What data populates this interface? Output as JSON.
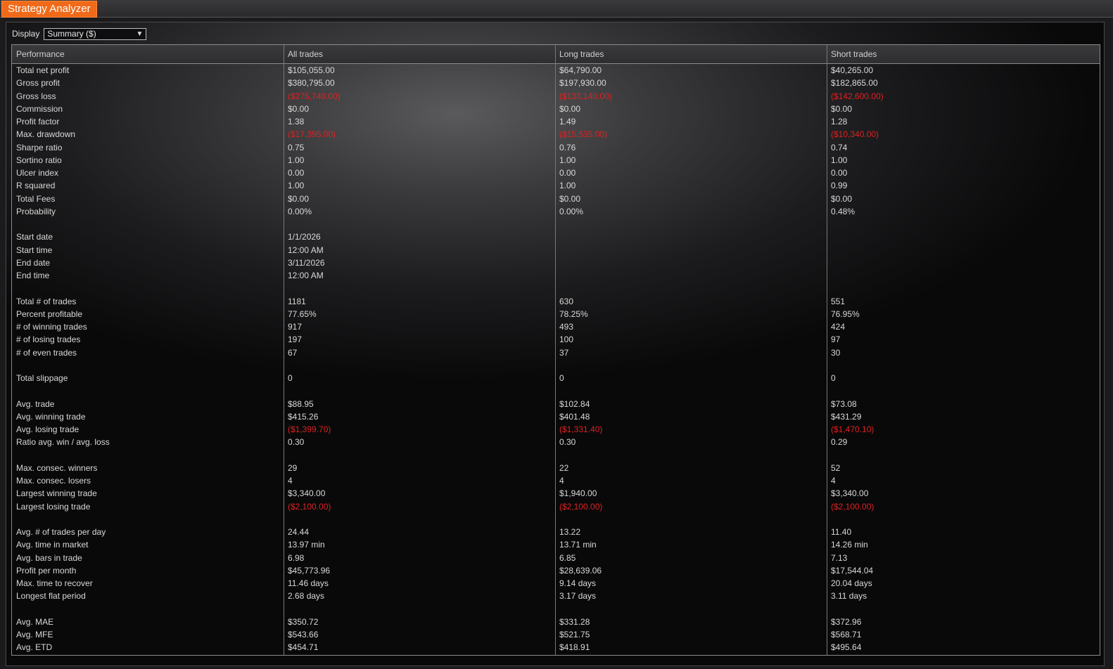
{
  "window": {
    "title": "Strategy Analyzer"
  },
  "display": {
    "label": "Display",
    "selected": "Summary ($)"
  },
  "columns": [
    "Performance",
    "All trades",
    "Long trades",
    "Short trades"
  ],
  "rows": [
    {
      "label": "Total net profit",
      "vals": [
        "$105,055.00",
        "$64,790.00",
        "$40,265.00"
      ]
    },
    {
      "label": "Gross profit",
      "vals": [
        "$380,795.00",
        "$197,930.00",
        "$182,865.00"
      ]
    },
    {
      "label": "Gross loss",
      "vals": [
        "($275,740.00)",
        "($133,140.00)",
        "($142,600.00)"
      ]
    },
    {
      "label": "Commission",
      "vals": [
        "$0.00",
        "$0.00",
        "$0.00"
      ]
    },
    {
      "label": "Profit factor",
      "vals": [
        "1.38",
        "1.49",
        "1.28"
      ]
    },
    {
      "label": "Max. drawdown",
      "vals": [
        "($17,395.00)",
        "($15,535.00)",
        "($10,340.00)"
      ]
    },
    {
      "label": "Sharpe ratio",
      "vals": [
        "0.75",
        "0.76",
        "0.74"
      ]
    },
    {
      "label": "Sortino ratio",
      "vals": [
        "1.00",
        "1.00",
        "1.00"
      ]
    },
    {
      "label": "Ulcer index",
      "vals": [
        "0.00",
        "0.00",
        "0.00"
      ]
    },
    {
      "label": "R squared",
      "vals": [
        "1.00",
        "1.00",
        "0.99"
      ]
    },
    {
      "label": "Total Fees",
      "vals": [
        "$0.00",
        "$0.00",
        "$0.00"
      ]
    },
    {
      "label": "Probability",
      "vals": [
        "0.00%",
        "0.00%",
        "0.48%"
      ]
    },
    {
      "label": "",
      "vals": [
        "",
        "",
        ""
      ]
    },
    {
      "label": "Start date",
      "vals": [
        "1/1/2026",
        "",
        ""
      ]
    },
    {
      "label": "Start time",
      "vals": [
        "12:00 AM",
        "",
        ""
      ]
    },
    {
      "label": "End date",
      "vals": [
        "3/11/2026",
        "",
        ""
      ]
    },
    {
      "label": "End time",
      "vals": [
        "12:00 AM",
        "",
        ""
      ]
    },
    {
      "label": "",
      "vals": [
        "",
        "",
        ""
      ]
    },
    {
      "label": "Total # of trades",
      "vals": [
        "1181",
        "630",
        "551"
      ]
    },
    {
      "label": "Percent profitable",
      "vals": [
        "77.65%",
        "78.25%",
        "76.95%"
      ]
    },
    {
      "label": "# of winning trades",
      "vals": [
        "917",
        "493",
        "424"
      ]
    },
    {
      "label": "# of losing trades",
      "vals": [
        "197",
        "100",
        "97"
      ]
    },
    {
      "label": "# of even trades",
      "vals": [
        "67",
        "37",
        "30"
      ]
    },
    {
      "label": "",
      "vals": [
        "",
        "",
        ""
      ]
    },
    {
      "label": "Total slippage",
      "vals": [
        "0",
        "0",
        "0"
      ]
    },
    {
      "label": "",
      "vals": [
        "",
        "",
        ""
      ]
    },
    {
      "label": "Avg. trade",
      "vals": [
        "$88.95",
        "$102.84",
        "$73.08"
      ]
    },
    {
      "label": "Avg. winning trade",
      "vals": [
        "$415.26",
        "$401.48",
        "$431.29"
      ]
    },
    {
      "label": "Avg. losing trade",
      "vals": [
        "($1,399.70)",
        "($1,331.40)",
        "($1,470.10)"
      ]
    },
    {
      "label": "Ratio avg. win / avg. loss",
      "vals": [
        "0.30",
        "0.30",
        "0.29"
      ]
    },
    {
      "label": "",
      "vals": [
        "",
        "",
        ""
      ]
    },
    {
      "label": "Max. consec. winners",
      "vals": [
        "29",
        "22",
        "52"
      ]
    },
    {
      "label": "Max. consec. losers",
      "vals": [
        "4",
        "4",
        "4"
      ]
    },
    {
      "label": "Largest winning trade",
      "vals": [
        "$3,340.00",
        "$1,940.00",
        "$3,340.00"
      ]
    },
    {
      "label": "Largest losing trade",
      "vals": [
        "($2,100.00)",
        "($2,100.00)",
        "($2,100.00)"
      ]
    },
    {
      "label": "",
      "vals": [
        "",
        "",
        ""
      ]
    },
    {
      "label": "Avg. # of trades per day",
      "vals": [
        "24.44",
        "13.22",
        "11.40"
      ]
    },
    {
      "label": "Avg. time in market",
      "vals": [
        "13.97 min",
        "13.71 min",
        "14.26 min"
      ]
    },
    {
      "label": "Avg. bars in trade",
      "vals": [
        "6.98",
        "6.85",
        "7.13"
      ]
    },
    {
      "label": "Profit per month",
      "vals": [
        "$45,773.96",
        "$28,639.06",
        "$17,544.04"
      ]
    },
    {
      "label": "Max. time to recover",
      "vals": [
        "11.46 days",
        "9.14 days",
        "20.04 days"
      ]
    },
    {
      "label": "Longest flat period",
      "vals": [
        "2.68 days",
        "3.17 days",
        "3.11 days"
      ]
    },
    {
      "label": "",
      "vals": [
        "",
        "",
        ""
      ]
    },
    {
      "label": "Avg. MAE",
      "vals": [
        "$350.72",
        "$331.28",
        "$372.96"
      ]
    },
    {
      "label": "Avg. MFE",
      "vals": [
        "$543.66",
        "$521.75",
        "$568.71"
      ]
    },
    {
      "label": "Avg. ETD",
      "vals": [
        "$454.71",
        "$418.91",
        "$495.64"
      ]
    }
  ],
  "colors": {
    "accent": "#f06a1a",
    "negative": "#e02020"
  }
}
